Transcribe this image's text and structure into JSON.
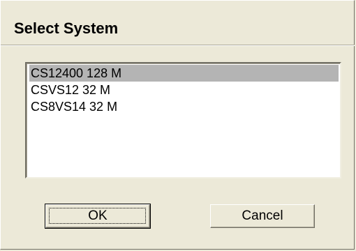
{
  "dialog": {
    "title": "Select System"
  },
  "listbox": {
    "items": [
      {
        "label": "CS12400 128 M",
        "selected": true
      },
      {
        "label": "CSVS12 32 M",
        "selected": false
      },
      {
        "label": "CS8VS14 32 M",
        "selected": false
      }
    ]
  },
  "buttons": {
    "ok_label": "OK",
    "cancel_label": "Cancel"
  },
  "colors": {
    "background": "#ECE9D8",
    "selection": "#B4B4B4"
  }
}
